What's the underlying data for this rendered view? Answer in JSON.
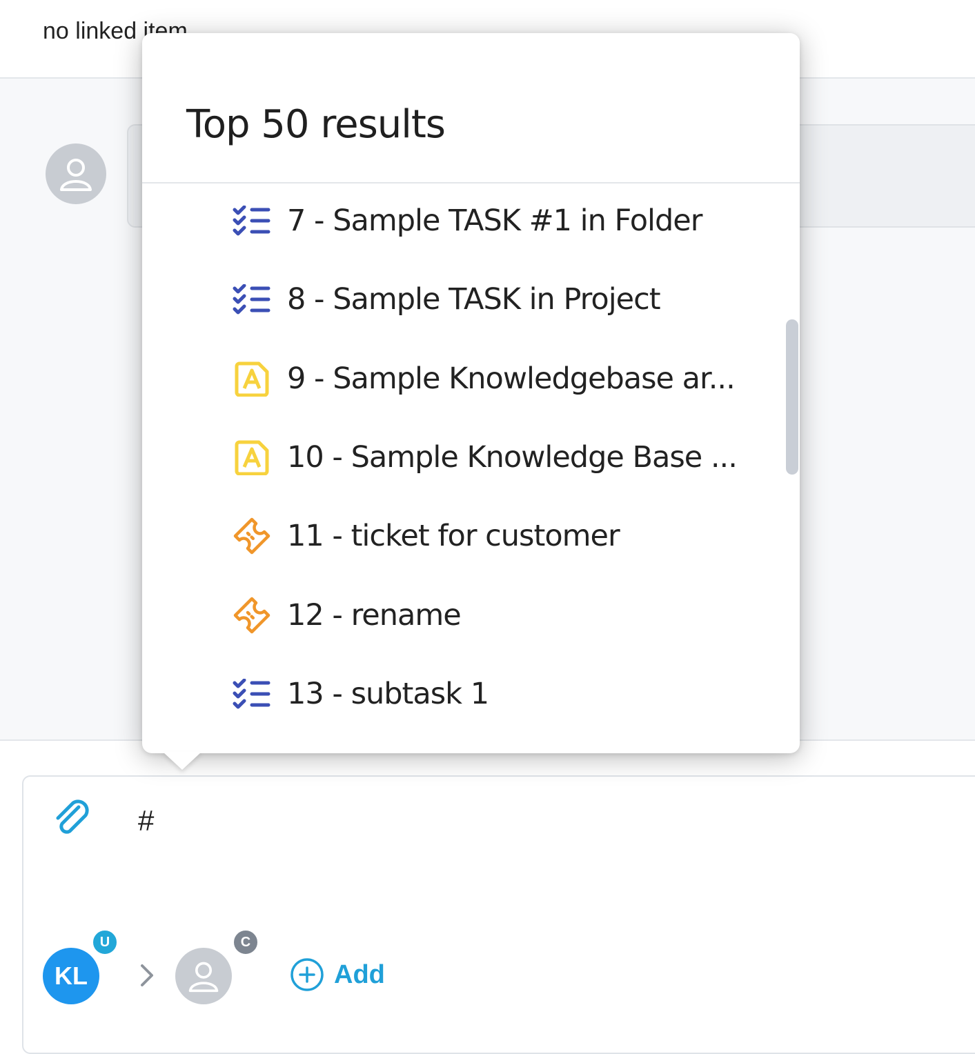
{
  "header": {
    "linked_status": "no linked item"
  },
  "popover": {
    "title": "Top 50 results",
    "results": [
      {
        "label": "7 - Sample TASK #1 in Folder",
        "icon": "task-list-icon"
      },
      {
        "label": "8 - Sample TASK in Project",
        "icon": "task-list-icon"
      },
      {
        "label": "9 - Sample Knowledgebase ar...",
        "icon": "knowledgebase-article-icon"
      },
      {
        "label": "10 - Sample Knowledge Base ...",
        "icon": "knowledgebase-article-icon"
      },
      {
        "label": "11 - ticket for customer",
        "icon": "ticket-icon"
      },
      {
        "label": "12 - rename",
        "icon": "ticket-icon"
      },
      {
        "label": "13 - subtask 1",
        "icon": "task-list-icon"
      }
    ]
  },
  "editor": {
    "typed_text": "#",
    "author_initials": "KL",
    "author_badge": "U",
    "recipient_badge": "C",
    "add_label": "Add"
  },
  "colors": {
    "task_icon": "#3b4fb5",
    "kb_icon": "#f7d23e",
    "ticket_icon": "#f0962a",
    "accent": "#20a0d8",
    "avatar_blue": "#1e96ee"
  }
}
